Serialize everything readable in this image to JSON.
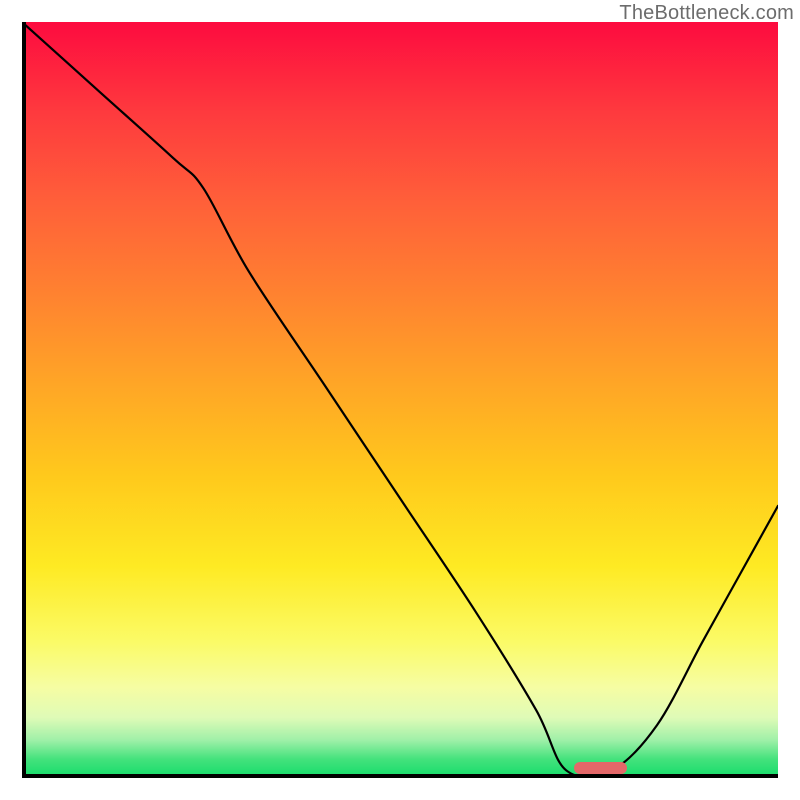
{
  "watermark": "TheBottleneck.com",
  "marker": {
    "x_pct": 73,
    "width_pct": 7
  },
  "chart_data": {
    "type": "line",
    "title": "",
    "xlabel": "",
    "ylabel": "",
    "xlim": [
      0,
      100
    ],
    "ylim": [
      0,
      100
    ],
    "x": [
      0,
      10,
      20,
      24,
      30,
      40,
      50,
      60,
      68,
      72,
      78,
      84,
      90,
      95,
      100
    ],
    "y": [
      100,
      91,
      82,
      78,
      67,
      52,
      37,
      22,
      9,
      1,
      1,
      7,
      18,
      27,
      36
    ]
  }
}
